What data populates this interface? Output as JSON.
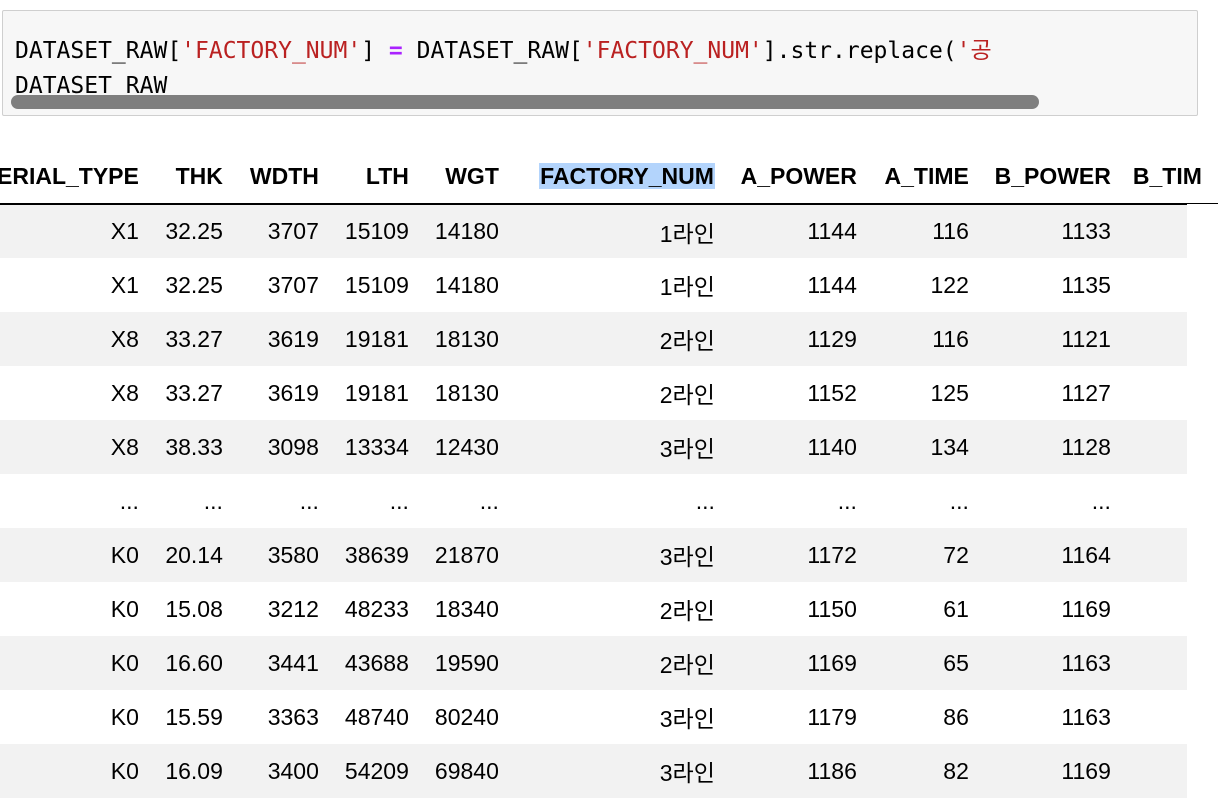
{
  "code": {
    "line1": {
      "p1": "DATASET_RAW[",
      "s1": "'FACTORY_NUM'",
      "p2": "] ",
      "op": "=",
      "p3": " DATASET_RAW[",
      "s2": "'FACTORY_NUM'",
      "p4": "].str.replace(",
      "s3": "'공"
    },
    "line2": "DATASET_RAW"
  },
  "table": {
    "columns": [
      "ERIAL_TYPE",
      "THK",
      "WDTH",
      "LTH",
      "WGT",
      "FACTORY_NUM",
      "A_POWER",
      "A_TIME",
      "B_POWER",
      "B_TIM"
    ],
    "highlighted_column": "FACTORY_NUM",
    "rows": [
      [
        "X1",
        "32.25",
        "3707",
        "15109",
        "14180",
        "1라인",
        "1144",
        "116",
        "1133",
        ""
      ],
      [
        "X1",
        "32.25",
        "3707",
        "15109",
        "14180",
        "1라인",
        "1144",
        "122",
        "1135",
        ""
      ],
      [
        "X8",
        "33.27",
        "3619",
        "19181",
        "18130",
        "2라인",
        "1129",
        "116",
        "1121",
        ""
      ],
      [
        "X8",
        "33.27",
        "3619",
        "19181",
        "18130",
        "2라인",
        "1152",
        "125",
        "1127",
        ""
      ],
      [
        "X8",
        "38.33",
        "3098",
        "13334",
        "12430",
        "3라인",
        "1140",
        "134",
        "1128",
        ""
      ],
      [
        "...",
        "...",
        "...",
        "...",
        "...",
        "...",
        "...",
        "...",
        "...",
        ""
      ],
      [
        "K0",
        "20.14",
        "3580",
        "38639",
        "21870",
        "3라인",
        "1172",
        "72",
        "1164",
        ""
      ],
      [
        "K0",
        "15.08",
        "3212",
        "48233",
        "18340",
        "2라인",
        "1150",
        "61",
        "1169",
        ""
      ],
      [
        "K0",
        "16.60",
        "3441",
        "43688",
        "19590",
        "2라인",
        "1169",
        "65",
        "1163",
        ""
      ],
      [
        "K0",
        "15.59",
        "3363",
        "48740",
        "80240",
        "3라인",
        "1179",
        "86",
        "1163",
        ""
      ],
      [
        "K0",
        "16.09",
        "3400",
        "54209",
        "69840",
        "3라인",
        "1186",
        "82",
        "1169",
        ""
      ]
    ]
  },
  "colors": {
    "string": "#ba2121",
    "operator": "#aa22ff",
    "highlight": "#b3d4fc",
    "stripe": "#f2f2f2"
  }
}
